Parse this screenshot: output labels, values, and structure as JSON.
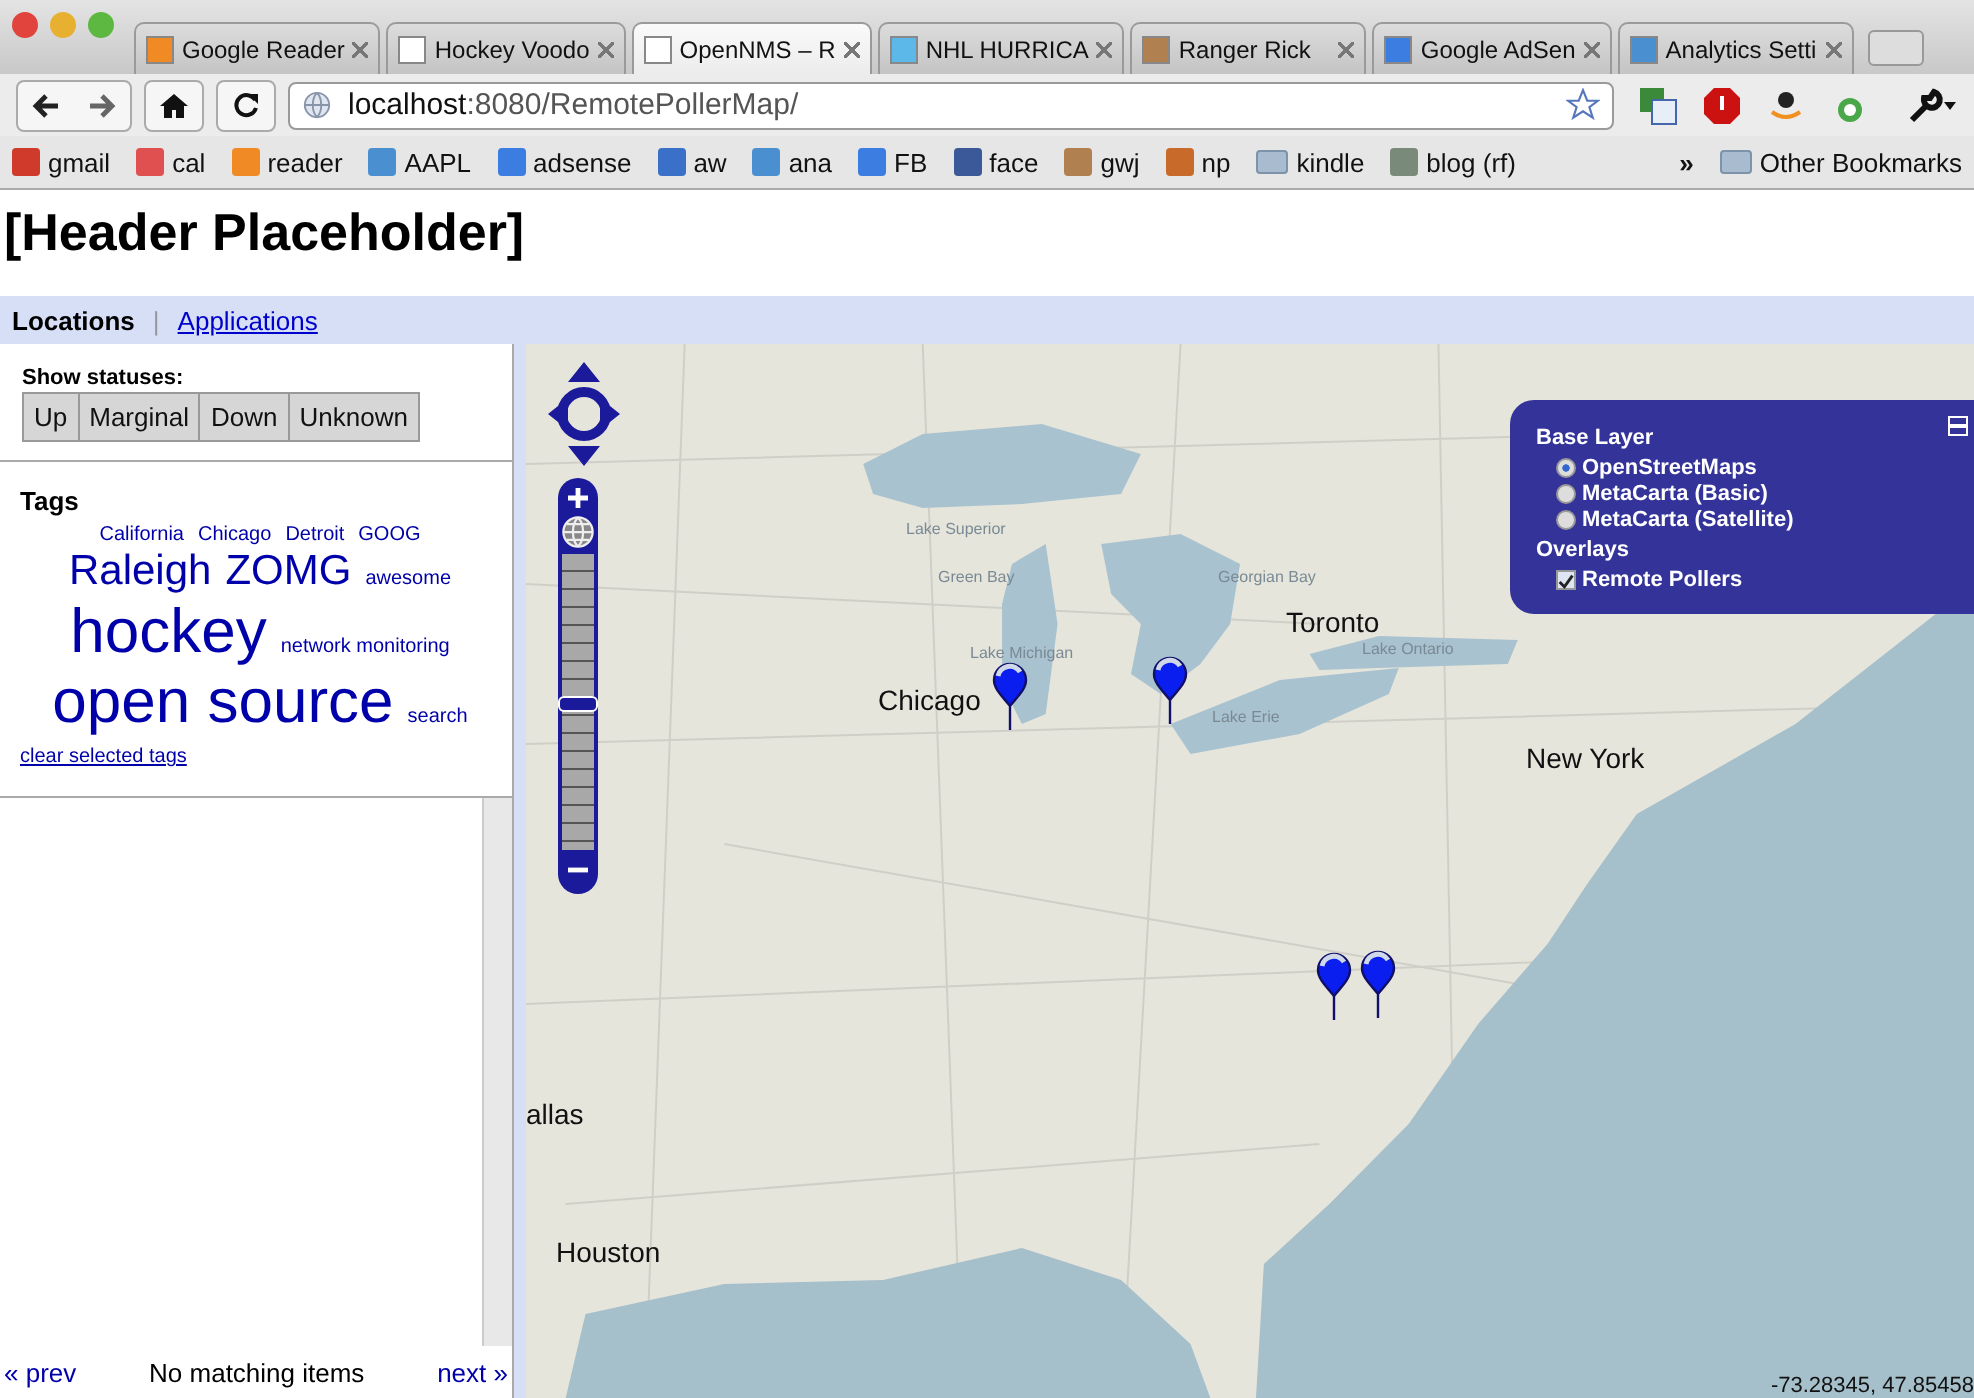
{
  "browser": {
    "tabs": [
      {
        "title": "Google Reader",
        "kind": "feed",
        "selected": false
      },
      {
        "title": "Hockey Voodo",
        "kind": "page",
        "selected": false
      },
      {
        "title": "OpenNMS – R",
        "kind": "page",
        "selected": true
      },
      {
        "title": "NHL HURRICA",
        "kind": "bird",
        "selected": false
      },
      {
        "title": "Ranger Rick",
        "kind": "face",
        "selected": false
      },
      {
        "title": "Google AdSen",
        "kind": "dots",
        "selected": false
      },
      {
        "title": "Analytics Setti",
        "kind": "chart",
        "selected": false
      }
    ],
    "url": {
      "host": "localhost",
      "rest": ":8080/RemotePollerMap/"
    },
    "bookmarks": [
      {
        "label": "gmail",
        "kind": "mail"
      },
      {
        "label": "cal",
        "kind": "cal"
      },
      {
        "label": "reader",
        "kind": "feed"
      },
      {
        "label": "AAPL",
        "kind": "chart"
      },
      {
        "label": "adsense",
        "kind": "dots"
      },
      {
        "label": "aw",
        "kind": "letter"
      },
      {
        "label": "ana",
        "kind": "chart"
      },
      {
        "label": "FB",
        "kind": "dots"
      },
      {
        "label": "face",
        "kind": "fb"
      },
      {
        "label": "gwj",
        "kind": "face"
      },
      {
        "label": "np",
        "kind": "bag"
      },
      {
        "label": "kindle",
        "kind": "folder"
      },
      {
        "label": "blog (rf)",
        "kind": "alien"
      }
    ],
    "more": "»",
    "other": "Other Bookmarks"
  },
  "header": "[Header Placeholder]",
  "nav": [
    {
      "label": "Locations",
      "selected": true
    },
    {
      "label": "Applications",
      "selected": false
    }
  ],
  "nav_separator": "|",
  "statuses": {
    "title": "Show statuses:",
    "buttons": [
      "Up",
      "Marginal",
      "Down",
      "Unknown"
    ]
  },
  "tags": {
    "title": "Tags",
    "items": [
      {
        "label": "California",
        "kind": "s"
      },
      {
        "label": "Chicago",
        "kind": "s"
      },
      {
        "label": "Detroit",
        "kind": "s"
      },
      {
        "label": "GOOG",
        "kind": "s"
      },
      {
        "label": "Raleigh",
        "kind": "m"
      },
      {
        "label": "ZOMG",
        "kind": "m"
      },
      {
        "label": "awesome",
        "kind": "s"
      },
      {
        "label": "hockey",
        "kind": "l"
      },
      {
        "label": "network monitoring",
        "kind": "s"
      },
      {
        "label": "open source",
        "kind": "l"
      },
      {
        "label": "search",
        "kind": "s"
      }
    ],
    "clear": "clear selected tags"
  },
  "pager": {
    "prev": "« prev",
    "status": "No matching items",
    "next": "next »"
  },
  "map": {
    "labels": [
      {
        "text": "Lake Superior",
        "kind": "lake"
      },
      {
        "text": "Green Bay",
        "kind": "lake"
      },
      {
        "text": "Georgian Bay",
        "kind": "lake"
      },
      {
        "text": "Lake Michigan",
        "kind": "lake"
      },
      {
        "text": "Toronto",
        "kind": "city"
      },
      {
        "text": "Lake Ontario",
        "kind": "lake"
      },
      {
        "text": "Chicago",
        "kind": "city"
      },
      {
        "text": "Lake Erie",
        "kind": "lake"
      },
      {
        "text": "New York",
        "kind": "city"
      },
      {
        "text": "allas",
        "kind": "city"
      },
      {
        "text": "Houston",
        "kind": "city"
      }
    ],
    "pins": [
      {
        "kind": "poller"
      },
      {
        "kind": "poller"
      },
      {
        "kind": "poller"
      },
      {
        "kind": "poller"
      }
    ],
    "layers": {
      "base_title": "Base Layer",
      "base": [
        {
          "label": "OpenStreetMaps",
          "selected": true
        },
        {
          "label": "MetaCarta (Basic)",
          "selected": false
        },
        {
          "label": "MetaCarta (Satellite)",
          "selected": false
        }
      ],
      "overlay_title": "Overlays",
      "overlays": [
        {
          "label": "Remote Pollers",
          "checked": true
        }
      ]
    },
    "zoom": {
      "level": 0.48
    },
    "coordinates": "-73.28345, 47.85458"
  }
}
